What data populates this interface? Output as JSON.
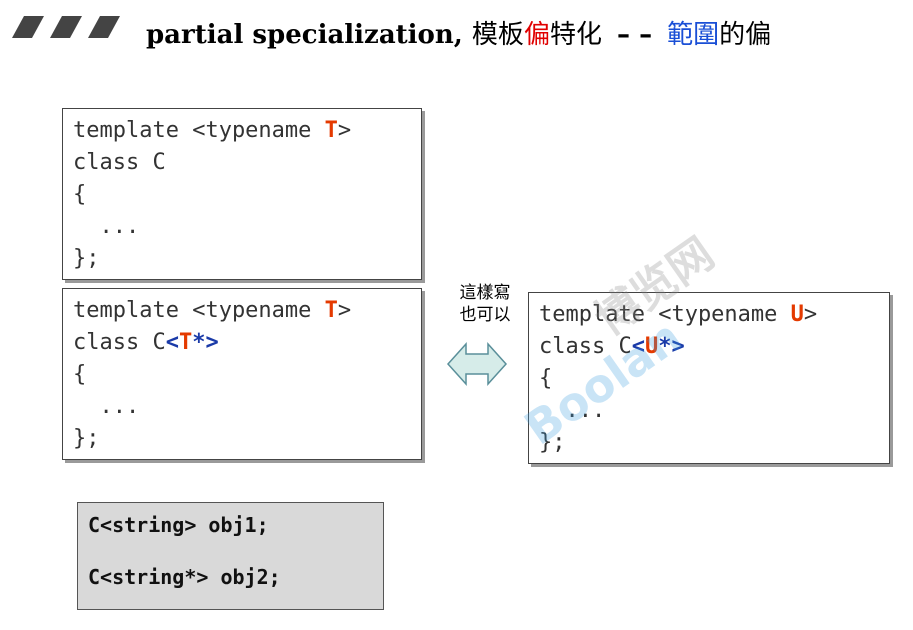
{
  "title": {
    "main": "partial specialization,",
    "cjk1": "模板",
    "cjk_red": "偏",
    "cjk2": "特化",
    "dash": "– –",
    "cjk_blue": "範圍",
    "cjk3": "的偏"
  },
  "box1": {
    "l1_pre": "template <typename ",
    "l1_t": "T",
    "l1_post": ">",
    "l2": "class C",
    "l3": "{",
    "l4": "  ...",
    "l5": "};"
  },
  "box2": {
    "l1_pre": "template <typename ",
    "l1_t": "T",
    "l1_post": ">",
    "l2_pre": "class C",
    "l2_lt": "<",
    "l2_t": "T",
    "l2_post": "*>",
    "l3": "{",
    "l4": "  ...",
    "l5": "};"
  },
  "box3": {
    "l1_pre": "template <typename ",
    "l1_u": "U",
    "l1_post": ">",
    "l2_pre": "class C",
    "l2_lt": "<",
    "l2_u": "U",
    "l2_post": "*>",
    "l3": "{",
    "l4": "  ...",
    "l5": "};"
  },
  "note": {
    "line1": "這樣寫",
    "line2": "也可以"
  },
  "objects": {
    "line1": "C<string> obj1;",
    "line2": "C<string*> obj2;"
  },
  "watermark": {
    "brand": "Boolan",
    "cjk": "博览网"
  },
  "colors": {
    "accent_red": "#e43a00",
    "accent_blue": "#1a3aa8",
    "arrow_fill": "#d6ece9"
  }
}
